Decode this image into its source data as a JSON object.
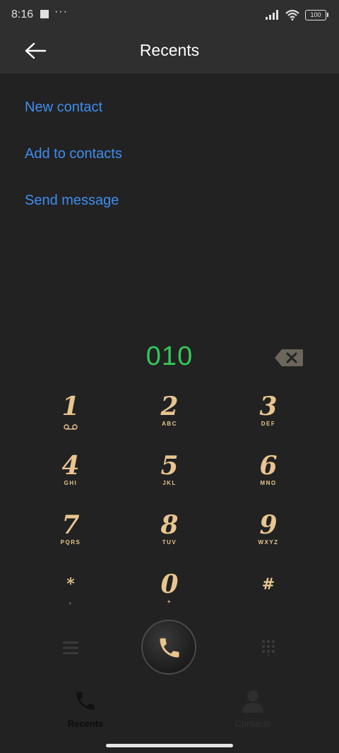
{
  "status": {
    "time": "8:16",
    "dots": "···",
    "battery": "100"
  },
  "header": {
    "title": "Recents"
  },
  "options": [
    {
      "label": "New contact"
    },
    {
      "label": "Add to contacts"
    },
    {
      "label": "Send message"
    }
  ],
  "dialer": {
    "number": "010",
    "keys": [
      {
        "digit": "1",
        "letters": ""
      },
      {
        "digit": "2",
        "letters": "ABC"
      },
      {
        "digit": "3",
        "letters": "DEF"
      },
      {
        "digit": "4",
        "letters": "GHI"
      },
      {
        "digit": "5",
        "letters": "JKL"
      },
      {
        "digit": "6",
        "letters": "MNO"
      },
      {
        "digit": "7",
        "letters": "PQRS"
      },
      {
        "digit": "8",
        "letters": "TUV"
      },
      {
        "digit": "9",
        "letters": "WXYZ"
      },
      {
        "digit": "*",
        "letters": ","
      },
      {
        "digit": "0",
        "letters": "+"
      },
      {
        "digit": "#",
        "letters": ""
      }
    ]
  },
  "tabs": [
    {
      "label": "Recents",
      "active": true
    },
    {
      "label": "Contacts",
      "active": false
    }
  ],
  "colors": {
    "accent_link": "#3f8df0",
    "number_green": "#34c759",
    "key_gold": "#e8c58f"
  }
}
